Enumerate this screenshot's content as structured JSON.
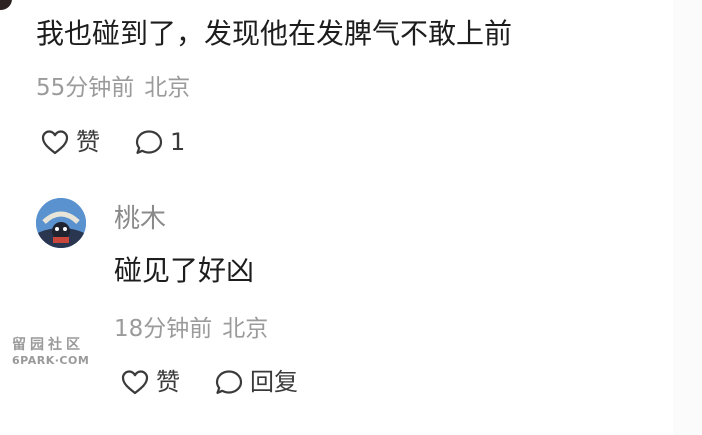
{
  "comments": [
    {
      "text": "我也碰到了，发现他在发脾气不敢上前",
      "time": "55分钟前",
      "location": "北京",
      "like_label": "赞",
      "reply_count": "1"
    }
  ],
  "reply": {
    "username": "桃木",
    "text": "碰见了好凶",
    "time": "18分钟前",
    "location": "北京",
    "like_label": "赞",
    "reply_label": "回复"
  },
  "watermark": {
    "cn": "留园社区",
    "en": "6PARK·COM"
  },
  "icons": {
    "like": "heart-outline-icon",
    "comment": "speech-bubble-icon"
  },
  "colors": {
    "text": "#1d1d1d",
    "meta": "#9b9b9b",
    "username": "#8a8a8a",
    "action": "#3a3a3a"
  }
}
